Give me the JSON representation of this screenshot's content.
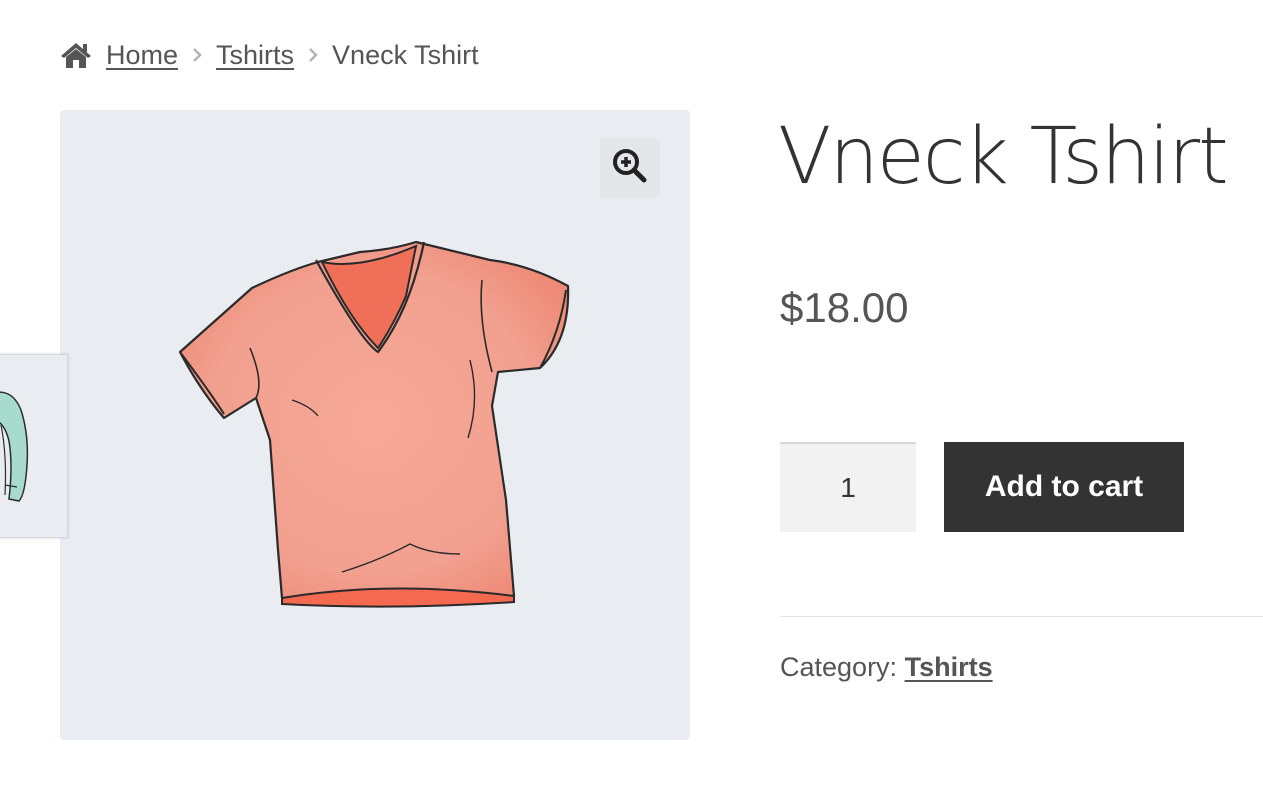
{
  "breadcrumb": {
    "home_icon": "home-icon",
    "separator_icon": "chevron-right-icon",
    "home": "Home",
    "category": "Tshirts",
    "current": "Vneck Tshirt"
  },
  "product": {
    "title": "Vneck Tshirt",
    "price": "$18.00",
    "quantity": "1",
    "add_to_cart": "Add to cart",
    "category_label": "Category:",
    "category_link": "Tshirts"
  },
  "gallery": {
    "zoom_icon": "zoom-in-icon",
    "main_image": "coral-vneck-tshirt-image",
    "side_thumb": "teal-hoodie-thumbnail"
  },
  "colors": {
    "button": "#333333",
    "gallery_bg": "#e9edf2",
    "shirt": "#f4a394"
  }
}
